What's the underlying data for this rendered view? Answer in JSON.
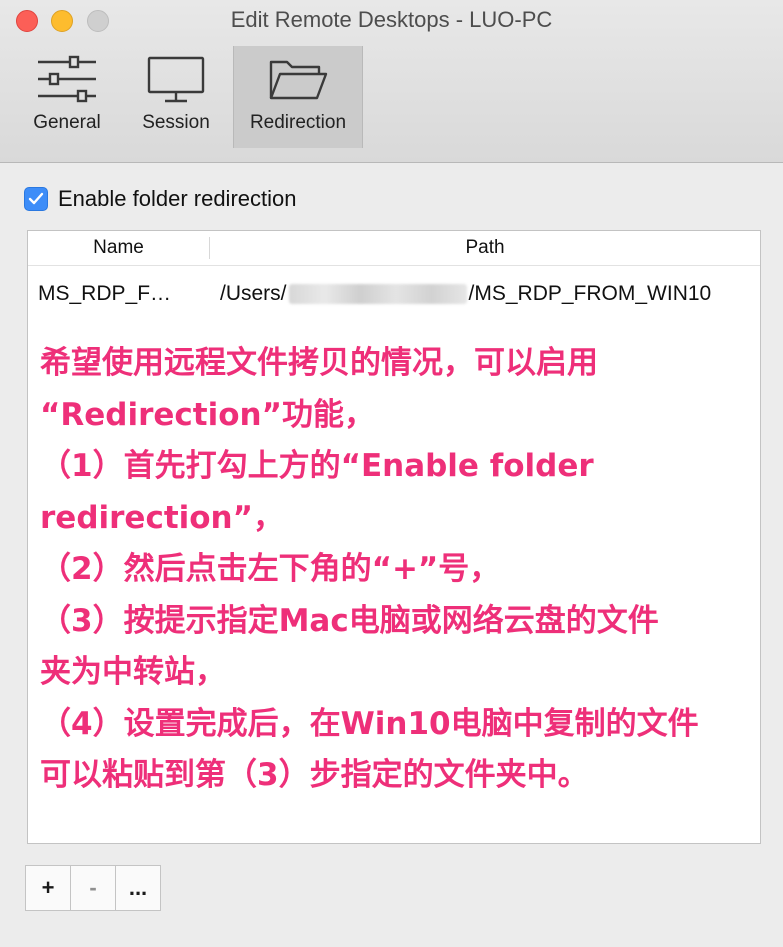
{
  "window": {
    "title": "Edit Remote Desktops - LUO-PC"
  },
  "toolbar": {
    "tabs": [
      {
        "label": "General",
        "icon": "sliders-icon"
      },
      {
        "label": "Session",
        "icon": "monitor-icon"
      },
      {
        "label": "Redirection",
        "icon": "folder-icon",
        "selected": true
      }
    ]
  },
  "redirection": {
    "checkbox_label": "Enable folder redirection",
    "checked": true,
    "table": {
      "columns": [
        "Name",
        "Path"
      ],
      "rows": [
        {
          "name": "MS_RDP_F…",
          "path_prefix": "/Users/",
          "path_suffix": "/MS_RDP_FROM_WIN10"
        }
      ]
    },
    "buttons": {
      "add": "+",
      "remove": "-",
      "more": "..."
    }
  },
  "annotation": {
    "color": "#ee2f79",
    "lines": [
      "希望使用远程文件拷贝的情况，可以启用",
      "“Redirection”功能，",
      "（1）首先打勾上方的“Enable folder",
      "redirection”，",
      "（2）然后点击左下角的“+”号，",
      "（3）按提示指定Mac电脑或网络云盘的文件",
      "夹为中转站，",
      "（4）设置完成后，在Win10电脑中复制的文件",
      "可以粘贴到第（3）步指定的文件夹中。"
    ]
  }
}
